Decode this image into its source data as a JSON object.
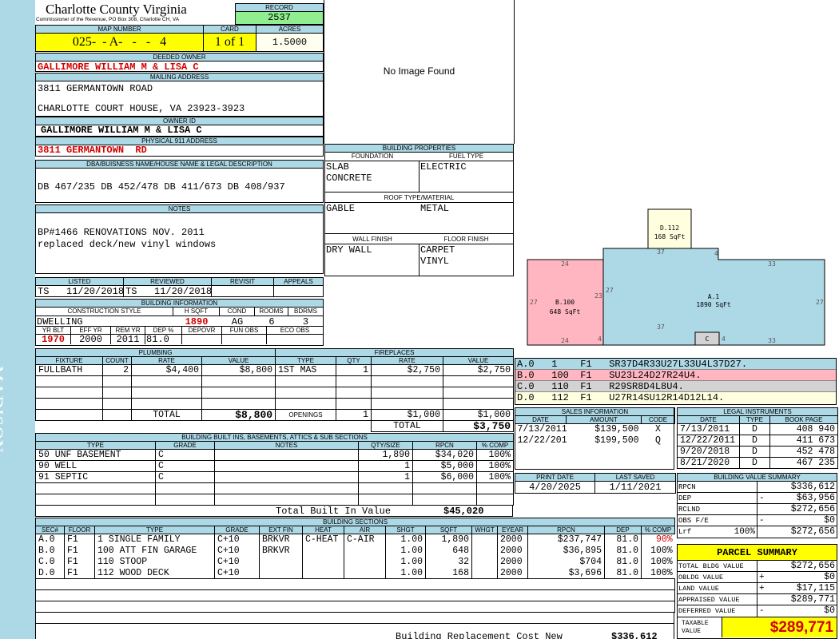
{
  "side_label": "MADISON",
  "header": {
    "county": "Charlotte County Virginia",
    "commissioner": "Commissioner of the Revenue, PO Box 308, Charlotte CH, VA",
    "record_label": "RECORD",
    "record_value": "2537",
    "map_number_label": "MAP NUMBER",
    "map_number": "025-  - A-   -   -   4",
    "card_label": "CARD",
    "card": "1 of 1",
    "acres_label": "ACRES",
    "acres": "1.5000"
  },
  "owner": {
    "deeded_label": "DEEDED OWNER",
    "deeded": "GALLIMORE WILLIAM M & LISA C",
    "mailing_label": "MAILING ADDRESS",
    "mailing_line1": "3811 GERMANTOWN ROAD",
    "mailing_line2": "CHARLOTTE COURT HOUSE, VA 23923-3923",
    "owner_id_label": "OWNER ID",
    "owner_id": "GALLIMORE WILLIAM M & LISA C",
    "physical_label": "PHYSICAL 911 ADDRESS",
    "physical": "3811 GERMANTOWN  RD",
    "dba_label": "DBA/BUISNESS NAME/HOUSE NAME & LEGAL DESCRIPTION",
    "dba": "DB 467/235 DB 452/478 DB 411/673 DB 408/937",
    "notes_label": "NOTES",
    "notes_line1": "BP#1466 RENOVATIONS NOV. 2011",
    "notes_line2": "replaced deck/new vinyl windows"
  },
  "image_text": "No Image Found",
  "review": {
    "listed_label": "LISTED",
    "listed": "TS   11/20/2018",
    "reviewed_label": "REVIEWED",
    "reviewed": "TS   11/20/2018",
    "revisit_label": "REVISIT",
    "appeals_label": "APPEALS"
  },
  "building_info": {
    "title": "BUILDING INFORMATION",
    "style_label": "CONSTRUCTION STYLE",
    "hsqft_label": "H SQFT",
    "cond_label": "COND",
    "rooms_label": "ROOMS",
    "bdrms_label": "BDRMS",
    "style": "DWELLING",
    "hsqft": "1890",
    "cond": "AG",
    "rooms": "6",
    "bdrms": "3",
    "yrblt_label": "YR BLT",
    "effyr_label": "EFF YR",
    "remyr_label": "REM YR",
    "dep_label": "DEP %",
    "depovr_label": "DEPOVR",
    "funobs_label": "FUN OBS",
    "ecoobs_label": "ECO OBS",
    "yrblt": "1970",
    "effyr": "2000",
    "remyr": "2011",
    "dep": "81.0"
  },
  "building_props": {
    "title": "BUILDING PROPERTIES",
    "foundation_label": "FOUNDATION",
    "fuel_label": "FUEL TYPE",
    "foundation1": "SLAB",
    "foundation2": "CONCRETE",
    "fuel": "ELECTRIC",
    "roof_label": "ROOF TYPE/MATERIAL",
    "roof_type": "GABLE",
    "roof_mat": "METAL",
    "wall_label": "WALL FINISH",
    "floor_label": "FLOOR FINISH",
    "wall": "DRY WALL",
    "floor1": "CARPET",
    "floor2": "VINYL"
  },
  "sketch": {
    "segments": [
      {
        "text": "A.0   1    F1   SR37D4R33U27L33U4L37D27.",
        "color": "#add8e6"
      },
      {
        "text": "B.0   100  F1   SU23L24D27R24U4.",
        "color": "#ffb6c1"
      },
      {
        "text": "C.0   110  F1   R29SR8D4L8U4.",
        "color": "#d3d3d3"
      },
      {
        "text": "D.0   112  F1   U27R14SU12R14D12L14.",
        "color": "#ffffe0"
      }
    ],
    "labels": {
      "a_name": "A.1",
      "a_area": "1890 SqFt",
      "b_name": "B.100",
      "b_area": "648 SqFt",
      "c_name": "C",
      "d_name": "D.112",
      "d_area": "168 SqFt",
      "dims": [
        "24",
        "27",
        "23",
        "4",
        "24",
        "37",
        "4",
        "33",
        "27",
        "27",
        "37",
        "4",
        "33"
      ]
    }
  },
  "plumbing": {
    "title": "PLUMBING",
    "headers": [
      "FIXTURE",
      "COUNT",
      "RATE",
      "VALUE"
    ],
    "rows": [
      [
        "FULLBATH",
        "2",
        "$4,400",
        "$8,800"
      ]
    ],
    "total_label": "TOTAL",
    "total": "$8,800"
  },
  "fireplaces": {
    "title": "FIREPLACES",
    "headers": [
      "TYPE",
      "QTY",
      "RATE",
      "VALUE"
    ],
    "rows": [
      [
        "1ST MAS",
        "1",
        "$2,750",
        "$2,750"
      ]
    ],
    "openings_label": "OPENINGS",
    "openings": [
      "1",
      "$1,000",
      "$1,000"
    ],
    "total_label": "TOTAL",
    "total": "$3,750"
  },
  "sales": {
    "title": "SALES INFORMATION",
    "headers": [
      "DATE",
      "AMOUNT",
      "CODE"
    ],
    "rows": [
      [
        "7/13/2011",
        "$139,500",
        "X"
      ],
      [
        "12/22/2011",
        "$199,500",
        "Q"
      ]
    ]
  },
  "legal": {
    "title": "LEGAL INSTRUMENTS",
    "headers": [
      "DATE",
      "TYPE",
      "BOOK PAGE"
    ],
    "rows": [
      [
        "7/13/2011",
        "D",
        "408 940"
      ],
      [
        "12/22/2011",
        "D",
        "411 673"
      ],
      [
        "9/20/2018",
        "D",
        "452 478"
      ],
      [
        "8/21/2020",
        "D",
        "467 235"
      ]
    ]
  },
  "builtins": {
    "title": "BUILDING BUILT INS, BASEMENTS, ATTICS & SUB SECTIONS",
    "headers": [
      "TYPE",
      "GRADE",
      "NOTES",
      "QTY/SIZE",
      "RPCN",
      "% COMP"
    ],
    "rows": [
      [
        "50 UNF BASEMENT",
        "C",
        "",
        "1,890",
        "$34,020",
        "100%"
      ],
      [
        "90 WELL",
        "C",
        "",
        "1",
        "$5,000",
        "100%"
      ],
      [
        "91 SEPTIC",
        "C",
        "",
        "1",
        "$6,000",
        "100%"
      ]
    ],
    "total_label": "Total Built In Value",
    "total": "$45,020"
  },
  "print": {
    "print_label": "PRINT DATE",
    "print_date": "4/20/2025",
    "saved_label": "LAST SAVED",
    "saved_date": "1/11/2021"
  },
  "value_summary": {
    "title": "BUILDING VALUE SUMMARY",
    "rows": [
      {
        "label": "RPCN",
        "pct": "",
        "sign": "",
        "value": "$336,612"
      },
      {
        "label": "DEP",
        "pct": "",
        "sign": "-",
        "value": "$63,956"
      },
      {
        "label": "RCLND",
        "pct": "",
        "sign": "",
        "value": "$272,656"
      },
      {
        "label": "OBS F/E",
        "pct": "",
        "sign": "-",
        "value": "$0"
      },
      {
        "label": "Lrf",
        "pct": "100%",
        "sign": "",
        "value": "$272,656"
      }
    ]
  },
  "sections": {
    "title": "BUILDING SECTIONS",
    "headers": [
      "SEC#",
      "FLOOR",
      "TYPE",
      "GRADE",
      "EXT FIN",
      "HEAT",
      "AIR",
      "SHGT",
      "SQFT",
      "WHGT",
      "EYEAR",
      "RPCN",
      "DEP",
      "% COMP"
    ],
    "rows": [
      [
        "A.0",
        "F1",
        "1 SINGLE FAMILY",
        "C+10",
        "BRKVR",
        "C-HEAT",
        "C-AIR",
        "1.00",
        "1,890",
        "",
        "2000",
        "$237,747",
        "81.0",
        "90%"
      ],
      [
        "B.0",
        "F1",
        "100 ATT FIN GARAGE",
        "C+10",
        "BRKVR",
        "",
        "",
        "1.00",
        "648",
        "",
        "2000",
        "$36,895",
        "81.0",
        "100%"
      ],
      [
        "C.0",
        "F1",
        "110 STOOP",
        "C+10",
        "",
        "",
        "",
        "1.00",
        "32",
        "",
        "2000",
        "$704",
        "81.0",
        "100%"
      ],
      [
        "D.0",
        "F1",
        "112 WOOD DECK",
        "C+10",
        "",
        "",
        "",
        "1.00",
        "168",
        "",
        "2000",
        "$3,696",
        "81.0",
        "100%"
      ]
    ],
    "total_label": "Building Replacement Cost New",
    "total": "$336,612"
  },
  "parcel": {
    "title": "PARCEL SUMMARY",
    "rows": [
      {
        "label": "TOTAL BLDG VALUE",
        "sign": "",
        "value": "$272,656"
      },
      {
        "label": "OBLDG VALUE",
        "sign": "+",
        "value": "$0"
      },
      {
        "label": "LAND VALUE",
        "sign": "+",
        "value": "$17,115"
      },
      {
        "label": "APPRAISED VALUE",
        "sign": "",
        "value": "$289,771"
      },
      {
        "label": "DEFERRED VALUE",
        "sign": "-",
        "value": "$0"
      }
    ],
    "taxable_label1": "TAXABLE",
    "taxable_label2": "VALUE",
    "taxable": "$289,771"
  }
}
